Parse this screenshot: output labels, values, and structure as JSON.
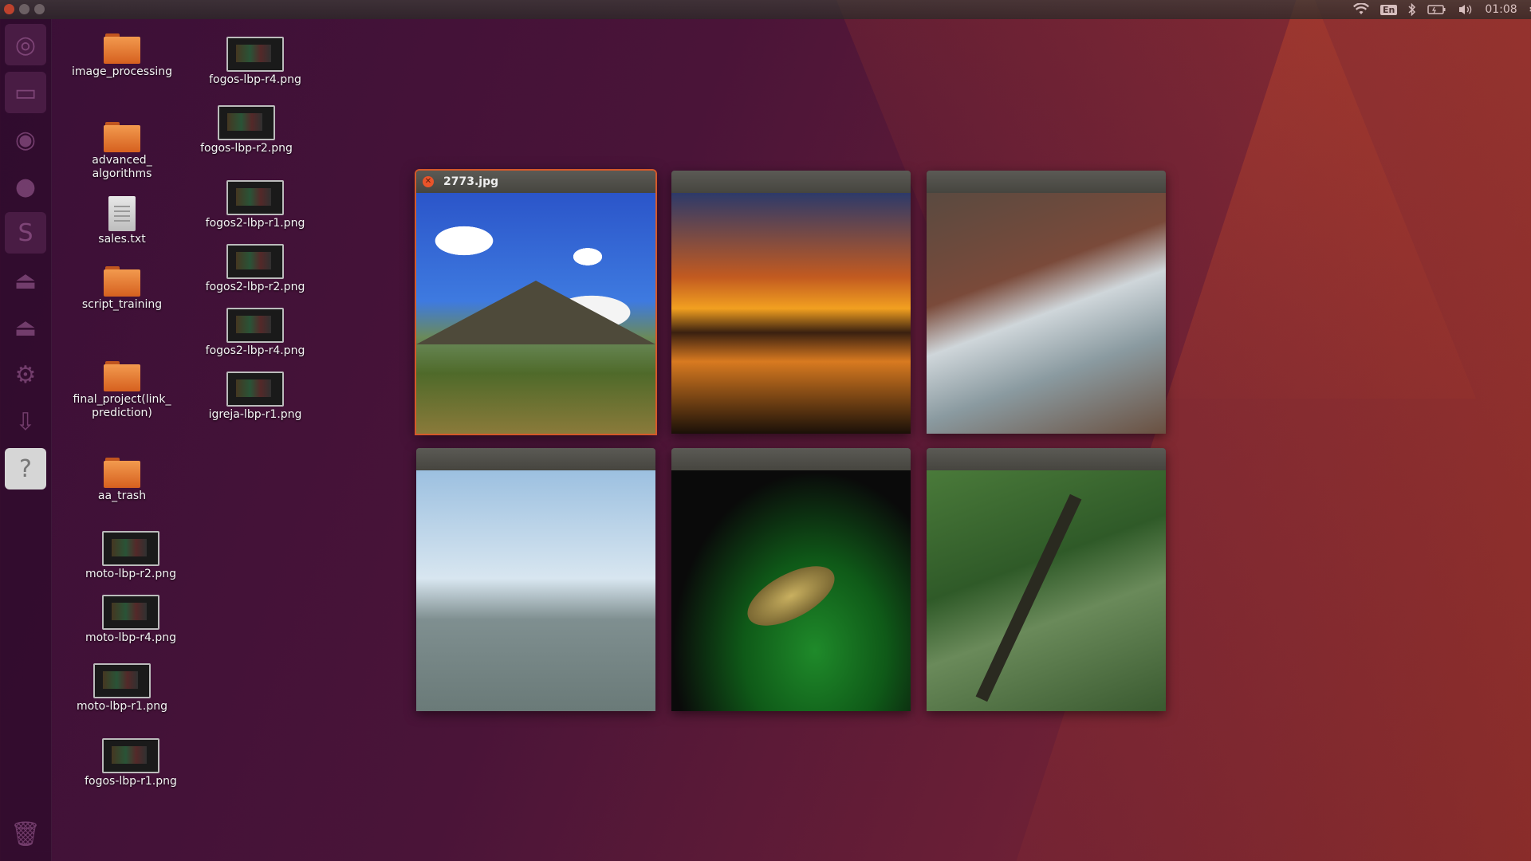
{
  "top_panel": {
    "time": "01:08",
    "keyboard_layout": "En"
  },
  "launcher": {
    "items": [
      "dash-home",
      "files",
      "chromium",
      "firefox",
      "libreoffice",
      "drive",
      "drive-2",
      "settings",
      "installer",
      "help"
    ]
  },
  "desktop": {
    "column1": [
      {
        "label": "image_processing",
        "type": "folder"
      },
      {
        "label": "advanced_\nalgorithms",
        "type": "folder"
      },
      {
        "label": "sales.txt",
        "type": "text"
      },
      {
        "label": "script_training",
        "type": "folder"
      },
      {
        "label": "final_project(link_\nprediction)",
        "type": "folder"
      },
      {
        "label": "aa_trash",
        "type": "folder"
      },
      {
        "label": "moto-lbp-r2.png",
        "type": "image"
      },
      {
        "label": "moto-lbp-r4.png",
        "type": "image"
      },
      {
        "label": "moto-lbp-r1.png",
        "type": "image"
      },
      {
        "label": "fogos-lbp-r1.png",
        "type": "image"
      }
    ],
    "column2": [
      {
        "label": "fogos-lbp-r4.png",
        "type": "image"
      },
      {
        "label": "fogos-lbp-r2.png",
        "type": "image"
      },
      {
        "label": "fogos2-lbp-r1.png",
        "type": "image"
      },
      {
        "label": "fogos2-lbp-r2.png",
        "type": "image"
      },
      {
        "label": "fogos2-lbp-r4.png",
        "type": "image"
      },
      {
        "label": "igreja-lbp-r1.png",
        "type": "image"
      }
    ]
  },
  "spread": {
    "active_title": "2773.jpg"
  }
}
